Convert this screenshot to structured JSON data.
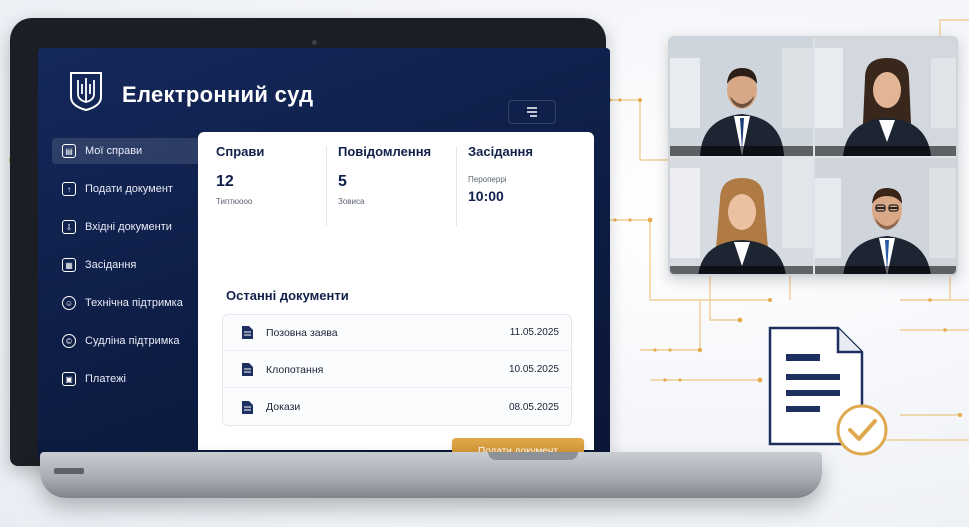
{
  "app": {
    "title": "Електронний суд",
    "menu_icon": "menu-icon"
  },
  "sidebar": {
    "items": [
      {
        "label": "Мої справи",
        "icon": "folder-icon",
        "active": true
      },
      {
        "label": "Подати документ",
        "icon": "file-upload-icon",
        "active": false
      },
      {
        "label": "Вхідні документи",
        "icon": "inbox-icon",
        "active": false
      },
      {
        "label": "Засідання",
        "icon": "calendar-icon",
        "active": false
      },
      {
        "label": "Технічна підтримка",
        "icon": "support-icon",
        "active": false
      },
      {
        "label": "Судліна підтримка",
        "icon": "help-icon",
        "active": false
      },
      {
        "label": "Платежі",
        "icon": "payment-icon",
        "active": false
      }
    ]
  },
  "stats": {
    "cases": {
      "title": "Справи",
      "value": "12",
      "sub": "Типтюооо"
    },
    "messages": {
      "title": "Повідомлення",
      "value": "5",
      "sub": "Зовиса"
    },
    "hearings": {
      "title": "Засідання",
      "sub": "Пероперрі",
      "time": "10:00"
    }
  },
  "documents": {
    "title": "Останні документи",
    "rows": [
      {
        "name": "Позовна заява",
        "date": "11.05.2025",
        "icon": "document-icon"
      },
      {
        "name": "Клопотання",
        "date": "10.05.2025",
        "icon": "document-icon"
      },
      {
        "name": "Докази",
        "date": "08.05.2025",
        "icon": "document-icon"
      }
    ]
  },
  "actions": {
    "submit_label": "Подати документ"
  },
  "video_call": {
    "participants": [
      {
        "role": "man",
        "tie": "#1e3f7a"
      },
      {
        "role": "woman"
      },
      {
        "role": "woman"
      },
      {
        "role": "man-glasses",
        "tie": "#2a5aa8"
      }
    ]
  },
  "colors": {
    "navy": "#10214b",
    "sidebar": "#14285a",
    "accent_gold": "#d99a38",
    "circuit": "#e8b86a"
  }
}
